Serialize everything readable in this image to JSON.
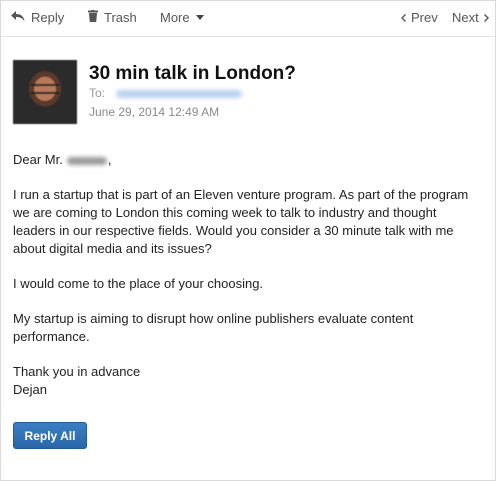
{
  "toolbar": {
    "reply_label": "Reply",
    "trash_label": "Trash",
    "more_label": "More",
    "prev_label": "Prev",
    "next_label": "Next",
    "icons": [
      "reply-arrow-icon",
      "trash-icon",
      "chevron-down-icon",
      "chevron-left-icon",
      "chevron-right-icon"
    ]
  },
  "message": {
    "subject": "30 min talk in London?",
    "to_label": "To:",
    "date": "June 29, 2014 12:49 AM",
    "greeting_prefix": "Dear Mr.",
    "greeting_suffix": ",",
    "paragraphs": [
      "I run a startup that is part of an Eleven venture program. As part of the program we are coming to London this coming week to talk to industry and thought leaders in our respective fields. Would you consider a 30 minute talk with me about digital media and its issues?",
      "I would come to the place of your choosing.",
      "My startup is aiming to disrupt how online publishers evaluate content performance."
    ],
    "closing": "Thank you in advance",
    "signature": "Dejan"
  },
  "actions": {
    "reply_all_label": "Reply All"
  },
  "colors": {
    "accent": "#2f6fb1",
    "muted": "#8a8a8a"
  }
}
